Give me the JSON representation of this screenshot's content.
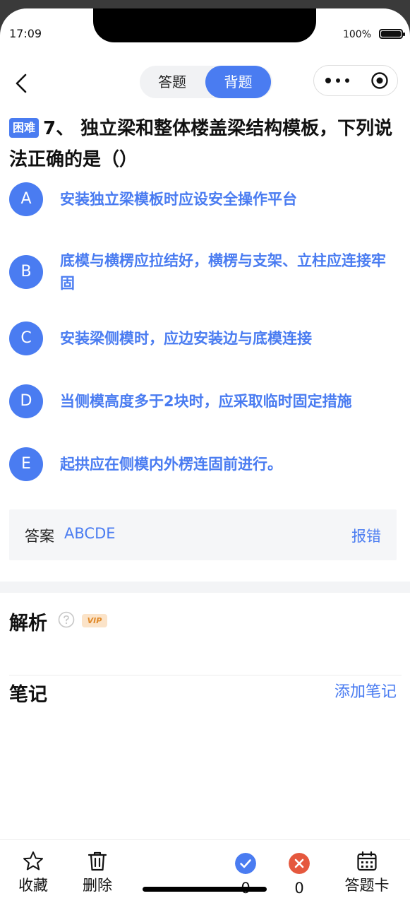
{
  "status": {
    "time": "17:09",
    "battery": "100%"
  },
  "nav": {
    "tab_answer": "答题",
    "tab_recite": "背题"
  },
  "question": {
    "difficulty": "困难",
    "title": "7、 独立梁和整体楼盖梁结构模板，下列说法正确的是（）",
    "options": [
      {
        "letter": "A",
        "text": "安装独立梁模板时应设安全操作平台"
      },
      {
        "letter": "B",
        "text": "底模与横楞应拉结好，横楞与支架、立柱应连接牢固"
      },
      {
        "letter": "C",
        "text": "安装梁侧模时，应边安装边与底模连接"
      },
      {
        "letter": "D",
        "text": "当侧模高度多于2块时，应采取临时固定措施"
      },
      {
        "letter": "E",
        "text": "起拱应在侧模内外楞连固前进行。"
      }
    ]
  },
  "answer": {
    "label": "答案",
    "value": "ABCDE",
    "report": "报错"
  },
  "analysis": {
    "title": "解析",
    "vip": "VIP"
  },
  "notes": {
    "title": "笔记",
    "add": "添加笔记"
  },
  "bottom": {
    "favorite": "收藏",
    "delete": "删除",
    "correct_count": "0",
    "wrong_count": "0",
    "answer_card": "答题卡"
  },
  "colors": {
    "accent": "#4a7cf1",
    "wrong": "#e5583e"
  }
}
